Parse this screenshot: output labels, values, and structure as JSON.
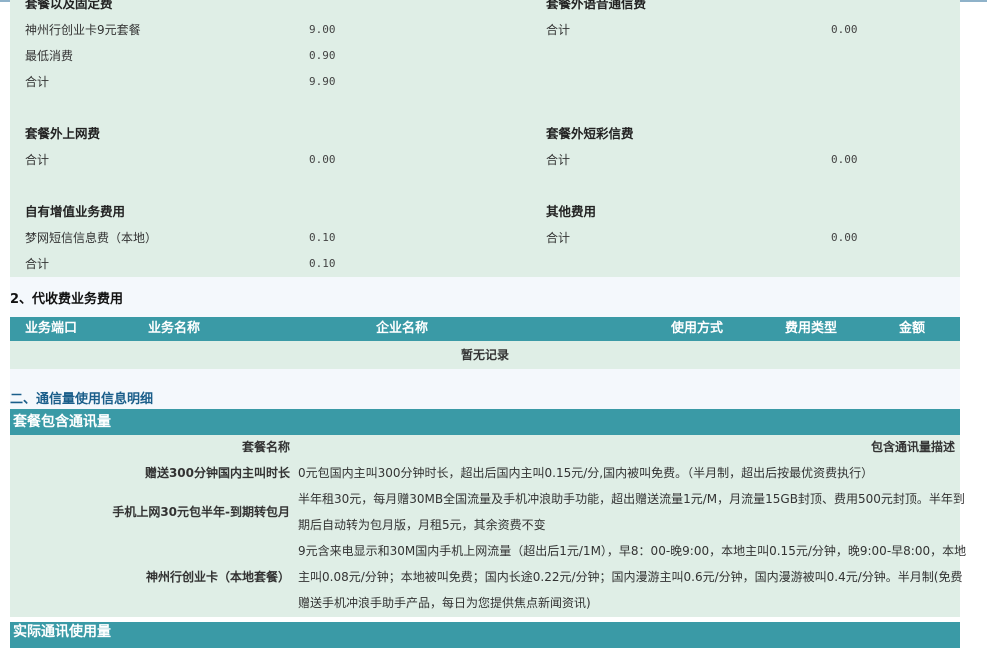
{
  "fixed_fees": {
    "package_fixed": {
      "title": "套餐以及固定费",
      "items": [
        {
          "label": "神州行创业卡9元套餐",
          "amount": "9.00"
        },
        {
          "label": "最低消费",
          "amount": "0.90"
        },
        {
          "label": "合计",
          "amount": "9.90"
        }
      ]
    },
    "extra_voice": {
      "title": "套餐外语音通信费",
      "items": [
        {
          "label": "合计",
          "amount": "0.00"
        }
      ]
    },
    "extra_internet": {
      "title": "套餐外上网费",
      "items": [
        {
          "label": "合计",
          "amount": "0.00"
        }
      ]
    },
    "extra_sms": {
      "title": "套餐外短彩信费",
      "items": [
        {
          "label": "合计",
          "amount": "0.00"
        }
      ]
    },
    "value_added": {
      "title": "自有增值业务费用",
      "items": [
        {
          "label": "梦网短信信息费（本地）",
          "amount": "0.10"
        },
        {
          "label": "合计",
          "amount": "0.10"
        }
      ]
    },
    "other": {
      "title": "其他费用",
      "items": [
        {
          "label": "合计",
          "amount": "0.00"
        }
      ]
    }
  },
  "agency": {
    "heading": "2、代收费业务费用",
    "columns": [
      "业务端口",
      "业务名称",
      "企业名称",
      "使用方式",
      "费用类型",
      "金额"
    ],
    "empty_text": "暂无记录"
  },
  "usage": {
    "heading": "二、通信量使用信息明细",
    "included_bar": "套餐包含通讯量",
    "col_name": "套餐名称",
    "col_desc": "包含通讯量描述",
    "packages": [
      {
        "name": "赠送300分钟国内主叫时长",
        "desc": "0元包国内主叫300分钟时长，超出后国内主叫0.15元/分,国内被叫免费。（半月制，超出后按最优资费执行）"
      },
      {
        "name": "手机上网30元包半年-到期转包月",
        "desc": "半年租30元，每月赠30MB全国流量及手机冲浪助手功能，超出赠送流量1元/M，月流量15GB封顶、费用500元封顶。半年到期后自动转为包月版，月租5元，其余资费不变"
      },
      {
        "name": "神州行创业卡（本地套餐）",
        "desc": "9元含来电显示和30M国内手机上网流量（超出后1元/1M），早8：00-晚9:00，本地主叫0.15元/分钟，晚9:00-早8:00，本地主叫0.08元/分钟；本地被叫免费；国内长途0.22元/分钟；国内漫游主叫0.6元/分钟，国内漫游被叫0.4元/分钟。半月制(免费赠送手机冲浪手助手产品，每日为您提供焦点新闻资讯)"
      }
    ],
    "bottom_bar": "实际通讯使用量"
  }
}
